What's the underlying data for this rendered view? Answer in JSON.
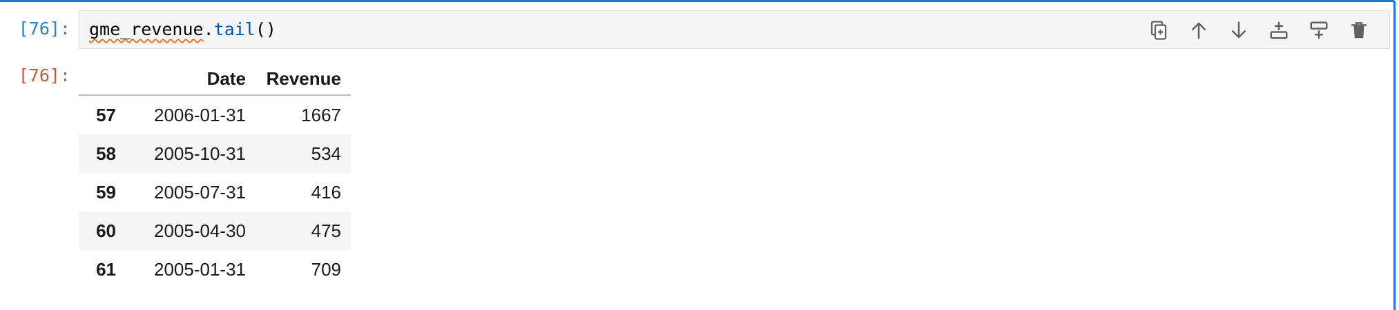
{
  "cell": {
    "input_prompt": "[76]:",
    "output_prompt": "[76]:",
    "code": {
      "variable": "gme_revenue",
      "dot": ".",
      "method": "tail",
      "parens": "()"
    }
  },
  "toolbar": [
    {
      "name": "duplicate-cell-button",
      "icon": "copy-icon"
    },
    {
      "name": "move-cell-up-button",
      "icon": "arrow-up-icon"
    },
    {
      "name": "move-cell-down-button",
      "icon": "arrow-down-icon"
    },
    {
      "name": "insert-cell-above-button",
      "icon": "insert-above-icon"
    },
    {
      "name": "insert-cell-below-button",
      "icon": "insert-below-icon"
    },
    {
      "name": "delete-cell-button",
      "icon": "trash-icon"
    }
  ],
  "table": {
    "columns": [
      "",
      "Date",
      "Revenue"
    ],
    "rows": [
      {
        "index": "57",
        "date": "2006-01-31",
        "revenue": "1667"
      },
      {
        "index": "58",
        "date": "2005-10-31",
        "revenue": "534"
      },
      {
        "index": "59",
        "date": "2005-07-31",
        "revenue": "416"
      },
      {
        "index": "60",
        "date": "2005-04-30",
        "revenue": "475"
      },
      {
        "index": "61",
        "date": "2005-01-31",
        "revenue": "709"
      }
    ]
  },
  "colors": {
    "active_border": "#1976d2",
    "input_prompt": "#307fc1",
    "output_prompt": "#bf5b3d",
    "method": "#0055aa",
    "icon": "#616161"
  }
}
